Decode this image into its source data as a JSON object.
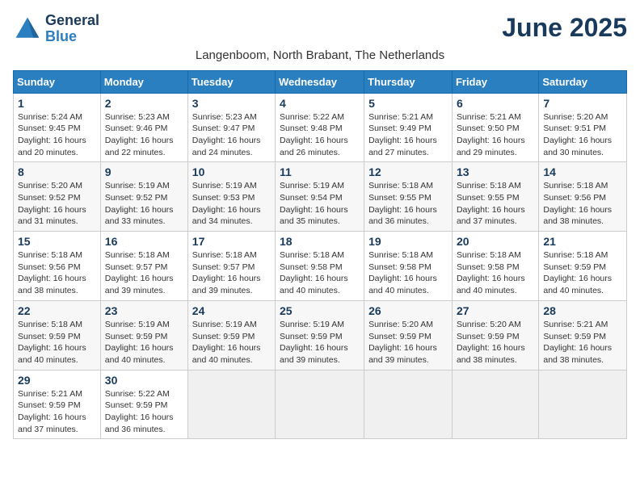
{
  "logo": {
    "line1": "General",
    "line2": "Blue"
  },
  "title": "June 2025",
  "subtitle": "Langenboom, North Brabant, The Netherlands",
  "weekdays": [
    "Sunday",
    "Monday",
    "Tuesday",
    "Wednesday",
    "Thursday",
    "Friday",
    "Saturday"
  ],
  "weeks": [
    [
      {
        "day": "1",
        "sunrise": "Sunrise: 5:24 AM",
        "sunset": "Sunset: 9:45 PM",
        "daylight": "Daylight: 16 hours and 20 minutes."
      },
      {
        "day": "2",
        "sunrise": "Sunrise: 5:23 AM",
        "sunset": "Sunset: 9:46 PM",
        "daylight": "Daylight: 16 hours and 22 minutes."
      },
      {
        "day": "3",
        "sunrise": "Sunrise: 5:23 AM",
        "sunset": "Sunset: 9:47 PM",
        "daylight": "Daylight: 16 hours and 24 minutes."
      },
      {
        "day": "4",
        "sunrise": "Sunrise: 5:22 AM",
        "sunset": "Sunset: 9:48 PM",
        "daylight": "Daylight: 16 hours and 26 minutes."
      },
      {
        "day": "5",
        "sunrise": "Sunrise: 5:21 AM",
        "sunset": "Sunset: 9:49 PM",
        "daylight": "Daylight: 16 hours and 27 minutes."
      },
      {
        "day": "6",
        "sunrise": "Sunrise: 5:21 AM",
        "sunset": "Sunset: 9:50 PM",
        "daylight": "Daylight: 16 hours and 29 minutes."
      },
      {
        "day": "7",
        "sunrise": "Sunrise: 5:20 AM",
        "sunset": "Sunset: 9:51 PM",
        "daylight": "Daylight: 16 hours and 30 minutes."
      }
    ],
    [
      {
        "day": "8",
        "sunrise": "Sunrise: 5:20 AM",
        "sunset": "Sunset: 9:52 PM",
        "daylight": "Daylight: 16 hours and 31 minutes."
      },
      {
        "day": "9",
        "sunrise": "Sunrise: 5:19 AM",
        "sunset": "Sunset: 9:52 PM",
        "daylight": "Daylight: 16 hours and 33 minutes."
      },
      {
        "day": "10",
        "sunrise": "Sunrise: 5:19 AM",
        "sunset": "Sunset: 9:53 PM",
        "daylight": "Daylight: 16 hours and 34 minutes."
      },
      {
        "day": "11",
        "sunrise": "Sunrise: 5:19 AM",
        "sunset": "Sunset: 9:54 PM",
        "daylight": "Daylight: 16 hours and 35 minutes."
      },
      {
        "day": "12",
        "sunrise": "Sunrise: 5:18 AM",
        "sunset": "Sunset: 9:55 PM",
        "daylight": "Daylight: 16 hours and 36 minutes."
      },
      {
        "day": "13",
        "sunrise": "Sunrise: 5:18 AM",
        "sunset": "Sunset: 9:55 PM",
        "daylight": "Daylight: 16 hours and 37 minutes."
      },
      {
        "day": "14",
        "sunrise": "Sunrise: 5:18 AM",
        "sunset": "Sunset: 9:56 PM",
        "daylight": "Daylight: 16 hours and 38 minutes."
      }
    ],
    [
      {
        "day": "15",
        "sunrise": "Sunrise: 5:18 AM",
        "sunset": "Sunset: 9:56 PM",
        "daylight": "Daylight: 16 hours and 38 minutes."
      },
      {
        "day": "16",
        "sunrise": "Sunrise: 5:18 AM",
        "sunset": "Sunset: 9:57 PM",
        "daylight": "Daylight: 16 hours and 39 minutes."
      },
      {
        "day": "17",
        "sunrise": "Sunrise: 5:18 AM",
        "sunset": "Sunset: 9:57 PM",
        "daylight": "Daylight: 16 hours and 39 minutes."
      },
      {
        "day": "18",
        "sunrise": "Sunrise: 5:18 AM",
        "sunset": "Sunset: 9:58 PM",
        "daylight": "Daylight: 16 hours and 40 minutes."
      },
      {
        "day": "19",
        "sunrise": "Sunrise: 5:18 AM",
        "sunset": "Sunset: 9:58 PM",
        "daylight": "Daylight: 16 hours and 40 minutes."
      },
      {
        "day": "20",
        "sunrise": "Sunrise: 5:18 AM",
        "sunset": "Sunset: 9:58 PM",
        "daylight": "Daylight: 16 hours and 40 minutes."
      },
      {
        "day": "21",
        "sunrise": "Sunrise: 5:18 AM",
        "sunset": "Sunset: 9:59 PM",
        "daylight": "Daylight: 16 hours and 40 minutes."
      }
    ],
    [
      {
        "day": "22",
        "sunrise": "Sunrise: 5:18 AM",
        "sunset": "Sunset: 9:59 PM",
        "daylight": "Daylight: 16 hours and 40 minutes."
      },
      {
        "day": "23",
        "sunrise": "Sunrise: 5:19 AM",
        "sunset": "Sunset: 9:59 PM",
        "daylight": "Daylight: 16 hours and 40 minutes."
      },
      {
        "day": "24",
        "sunrise": "Sunrise: 5:19 AM",
        "sunset": "Sunset: 9:59 PM",
        "daylight": "Daylight: 16 hours and 40 minutes."
      },
      {
        "day": "25",
        "sunrise": "Sunrise: 5:19 AM",
        "sunset": "Sunset: 9:59 PM",
        "daylight": "Daylight: 16 hours and 39 minutes."
      },
      {
        "day": "26",
        "sunrise": "Sunrise: 5:20 AM",
        "sunset": "Sunset: 9:59 PM",
        "daylight": "Daylight: 16 hours and 39 minutes."
      },
      {
        "day": "27",
        "sunrise": "Sunrise: 5:20 AM",
        "sunset": "Sunset: 9:59 PM",
        "daylight": "Daylight: 16 hours and 38 minutes."
      },
      {
        "day": "28",
        "sunrise": "Sunrise: 5:21 AM",
        "sunset": "Sunset: 9:59 PM",
        "daylight": "Daylight: 16 hours and 38 minutes."
      }
    ],
    [
      {
        "day": "29",
        "sunrise": "Sunrise: 5:21 AM",
        "sunset": "Sunset: 9:59 PM",
        "daylight": "Daylight: 16 hours and 37 minutes."
      },
      {
        "day": "30",
        "sunrise": "Sunrise: 5:22 AM",
        "sunset": "Sunset: 9:59 PM",
        "daylight": "Daylight: 16 hours and 36 minutes."
      },
      null,
      null,
      null,
      null,
      null
    ]
  ]
}
